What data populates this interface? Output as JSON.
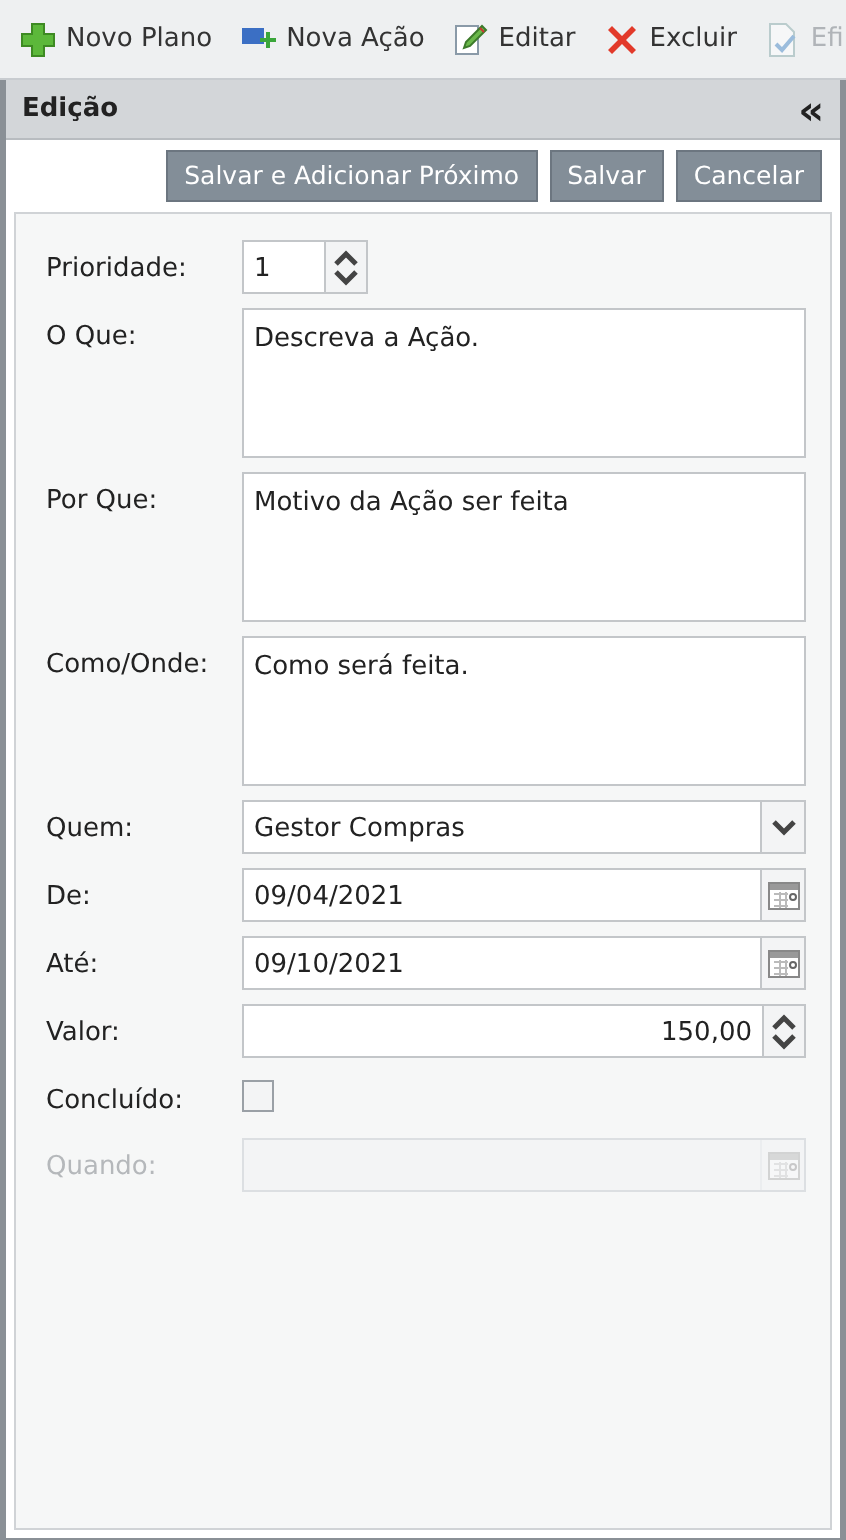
{
  "toolbar": [
    {
      "label": "Novo Plano",
      "kind": "add",
      "disabled": false
    },
    {
      "label": "Nova Ação",
      "kind": "new",
      "disabled": false
    },
    {
      "label": "Editar",
      "kind": "edit",
      "disabled": false
    },
    {
      "label": "Excluir",
      "kind": "delete",
      "disabled": false
    },
    {
      "label": "Efi",
      "kind": "doc",
      "disabled": true
    }
  ],
  "panel": {
    "title": "Edição",
    "collapse": "«"
  },
  "buttons": [
    "Salvar e Adicionar Próximo",
    "Salvar",
    "Cancelar"
  ],
  "fields": [
    {
      "label": "Prioridade:",
      "kind": "spinner",
      "value": "1",
      "disabled": false
    },
    {
      "label": "O Que:",
      "kind": "textarea",
      "value": "Descreva a Ação.",
      "disabled": false
    },
    {
      "label": "Por Que:",
      "kind": "textarea",
      "value": "Motivo da Ação ser feita",
      "disabled": false
    },
    {
      "label": "Como/Onde:",
      "kind": "textarea",
      "value": "Como será feita.",
      "disabled": false
    },
    {
      "label": "Quem:",
      "kind": "select",
      "value": "Gestor Compras",
      "disabled": false
    },
    {
      "label": "De:",
      "kind": "date",
      "value": "09/04/2021",
      "disabled": false
    },
    {
      "label": "Até:",
      "kind": "date",
      "value": "09/10/2021",
      "disabled": false
    },
    {
      "label": "Valor:",
      "kind": "number",
      "value": "150,00",
      "disabled": false
    },
    {
      "label": "Concluído:",
      "kind": "checkbox",
      "checked": false,
      "disabled": false
    },
    {
      "label": "Quando:",
      "kind": "date",
      "disabled": true
    }
  ]
}
